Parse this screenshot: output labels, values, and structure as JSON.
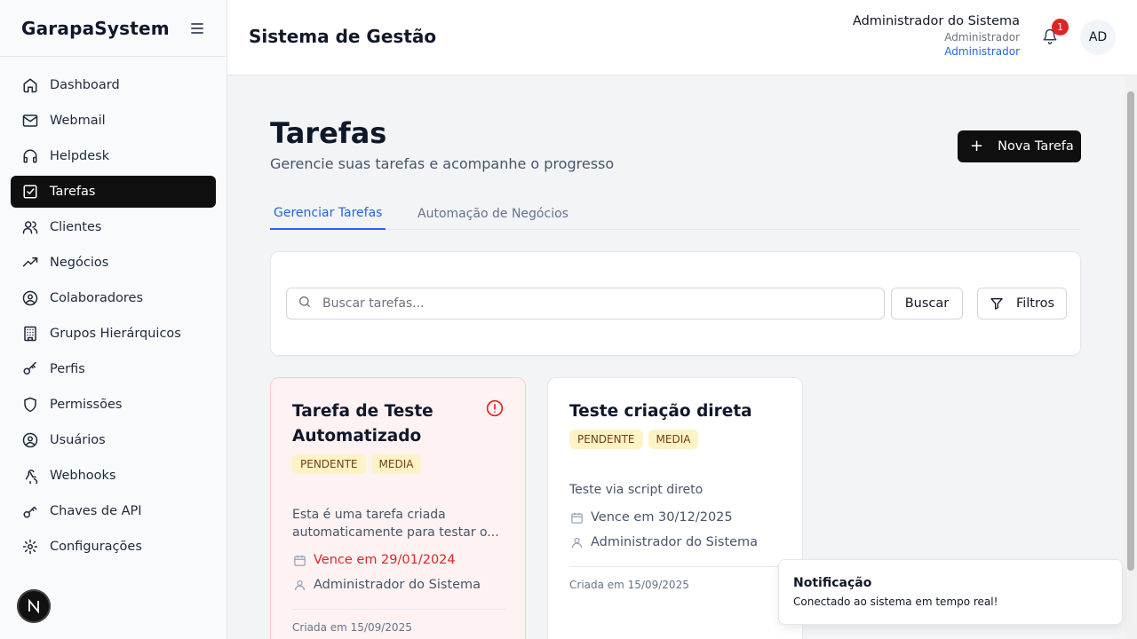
{
  "app": {
    "brand": "GarapaSystem"
  },
  "sidebar": {
    "items": [
      {
        "label": "Dashboard",
        "icon": "home-icon"
      },
      {
        "label": "Webmail",
        "icon": "mail-icon"
      },
      {
        "label": "Helpdesk",
        "icon": "headphones-icon"
      },
      {
        "label": "Tarefas",
        "icon": "checkbox-icon",
        "active": true
      },
      {
        "label": "Clientes",
        "icon": "users-icon"
      },
      {
        "label": "Negócios",
        "icon": "trending-up-icon"
      },
      {
        "label": "Colaboradores",
        "icon": "user-circle-icon"
      },
      {
        "label": "Grupos Hierárquicos",
        "icon": "building-icon"
      },
      {
        "label": "Perfis",
        "icon": "key-icon"
      },
      {
        "label": "Permissões",
        "icon": "shield-icon"
      },
      {
        "label": "Usuários",
        "icon": "user-circle-icon"
      },
      {
        "label": "Webhooks",
        "icon": "webhook-icon"
      },
      {
        "label": "Chaves de API",
        "icon": "key-icon"
      },
      {
        "label": "Configurações",
        "icon": "gear-icon"
      }
    ],
    "footer_badge": "N"
  },
  "header": {
    "title": "Sistema de Gestão",
    "user_name": "Administrador do Sistema",
    "user_role": "Administrador",
    "user_link": "Administrador",
    "notifications_count": "1",
    "avatar_initials": "AD"
  },
  "page": {
    "title": "Tarefas",
    "subtitle": "Gerencie suas tarefas e acompanhe o progresso",
    "new_button": "Nova Tarefa",
    "tabs": [
      {
        "label": "Gerenciar Tarefas",
        "active": true
      },
      {
        "label": "Automação de Negócios",
        "active": false
      }
    ]
  },
  "search": {
    "placeholder": "Buscar tarefas...",
    "value": "",
    "search_button": "Buscar",
    "filters_button": "Filtros"
  },
  "tasks": [
    {
      "title": "Tarefa de Teste Automatizado",
      "status": "PENDENTE",
      "priority": "MEDIA",
      "description": "Esta é uma tarefa criada automaticamente para testar o...",
      "due": "Vence em 29/01/2024",
      "overdue": true,
      "assignee": "Administrador do Sistema",
      "created": "Criada em 15/09/2025"
    },
    {
      "title": "Teste criação direta",
      "status": "PENDENTE",
      "priority": "MEDIA",
      "description": "Teste via script direto",
      "due": "Vence em 30/12/2025",
      "overdue": false,
      "assignee": "Administrador do Sistema",
      "created": "Criada em 15/09/2025"
    }
  ],
  "toast": {
    "title": "Notificação",
    "message": "Conectado ao sistema em tempo real!"
  },
  "colors": {
    "accent": "#2563eb",
    "primary_button": "#0f0f0f",
    "danger": "#dc2626",
    "badge_bg": "#fef3c7",
    "overdue_card_bg": "#fef2f2"
  }
}
